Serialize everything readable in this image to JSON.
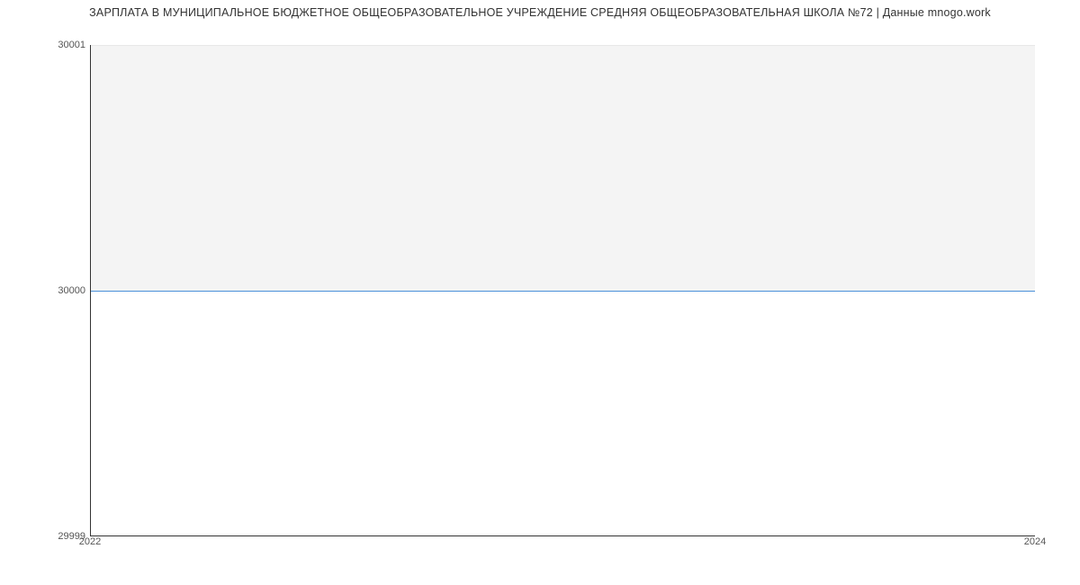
{
  "chart_data": {
    "type": "area",
    "title": "ЗАРПЛАТА В МУНИЦИПАЛЬНОЕ БЮДЖЕТНОЕ ОБЩЕОБРАЗОВАТЕЛЬНОЕ УЧРЕЖДЕНИЕ СРЕДНЯЯ ОБЩЕОБРАЗОВАТЕЛЬНАЯ ШКОЛА №72 | Данные mnogo.work",
    "x": [
      2022,
      2024
    ],
    "values": [
      30000,
      30000
    ],
    "xlabel": "",
    "ylabel": "",
    "xlim": [
      2022,
      2024
    ],
    "ylim": [
      29999,
      30001
    ],
    "x_ticks": [
      "2022",
      "2024"
    ],
    "y_ticks": [
      "29999",
      "30000",
      "30001"
    ],
    "colors": {
      "line": "#4a90d9",
      "fill": "#f4f4f4"
    }
  }
}
